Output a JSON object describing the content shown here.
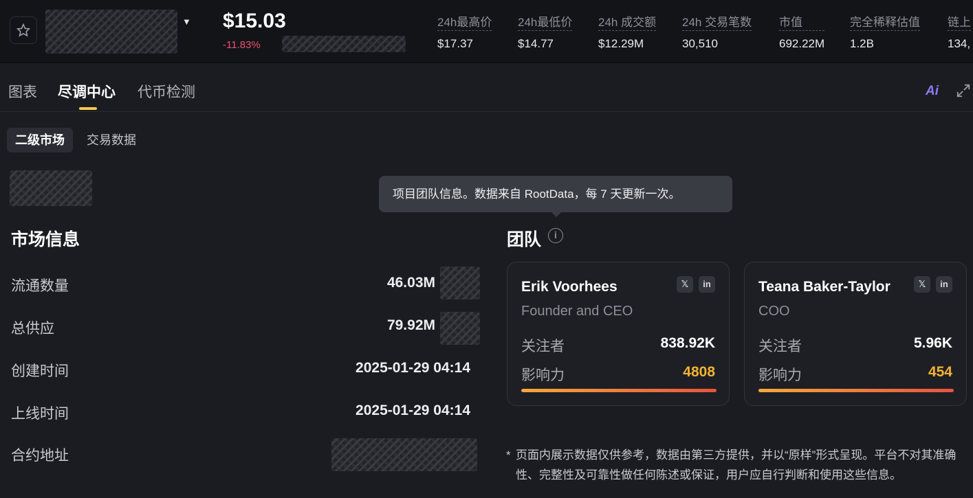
{
  "header": {
    "price": "$15.03",
    "change": "-11.83%",
    "stats": [
      {
        "label": "24h最高价",
        "value": "$17.37"
      },
      {
        "label": "24h最低价",
        "value": "$14.77"
      },
      {
        "label": "24h 成交额",
        "value": "$12.29M"
      },
      {
        "label": "24h 交易笔数",
        "value": "30,510"
      },
      {
        "label": "市值",
        "value": "692.22M"
      },
      {
        "label": "完全稀释估值",
        "value": "1.2B"
      },
      {
        "label": "链上",
        "value": "134,"
      }
    ]
  },
  "tabs": [
    {
      "label": "图表",
      "active": false
    },
    {
      "label": "尽调中心",
      "active": true
    },
    {
      "label": "代币检测",
      "active": false
    }
  ],
  "ai_label": "Ai",
  "subtabs": [
    {
      "label": "二级市场",
      "active": true
    },
    {
      "label": "交易数据",
      "active": false
    }
  ],
  "market": {
    "title": "市场信息",
    "rows": [
      {
        "label": "流通数量",
        "value": "46.03M"
      },
      {
        "label": "总供应",
        "value": "79.92M"
      },
      {
        "label": "创建时间",
        "value": "2025-01-29 04:14"
      },
      {
        "label": "上线时间",
        "value": "2025-01-29 04:14"
      },
      {
        "label": "合约地址",
        "value": ""
      }
    ]
  },
  "team": {
    "title": "团队",
    "tooltip": "项目团队信息。数据来自 RootData，每 7 天更新一次。",
    "members": [
      {
        "name": "Erik Voorhees",
        "role": "Founder and CEO",
        "followers_label": "关注者",
        "followers": "838.92K",
        "influence_label": "影响力",
        "influence": "4808"
      },
      {
        "name": "Teana Baker-Taylor",
        "role": "COO",
        "followers_label": "关注者",
        "followers": "5.96K",
        "influence_label": "影响力",
        "influence": "454"
      }
    ]
  },
  "disclaimer": "页面内展示数据仅供参考，数据由第三方提供，并以“原样”形式呈现。平台不对其准确性、完整性及可靠性做任何陈述或保证，用户应自行判断和使用这些信息。",
  "colors": {
    "accent": "#f2c94c",
    "negative": "#f0506e",
    "influence": "#f2b233"
  }
}
